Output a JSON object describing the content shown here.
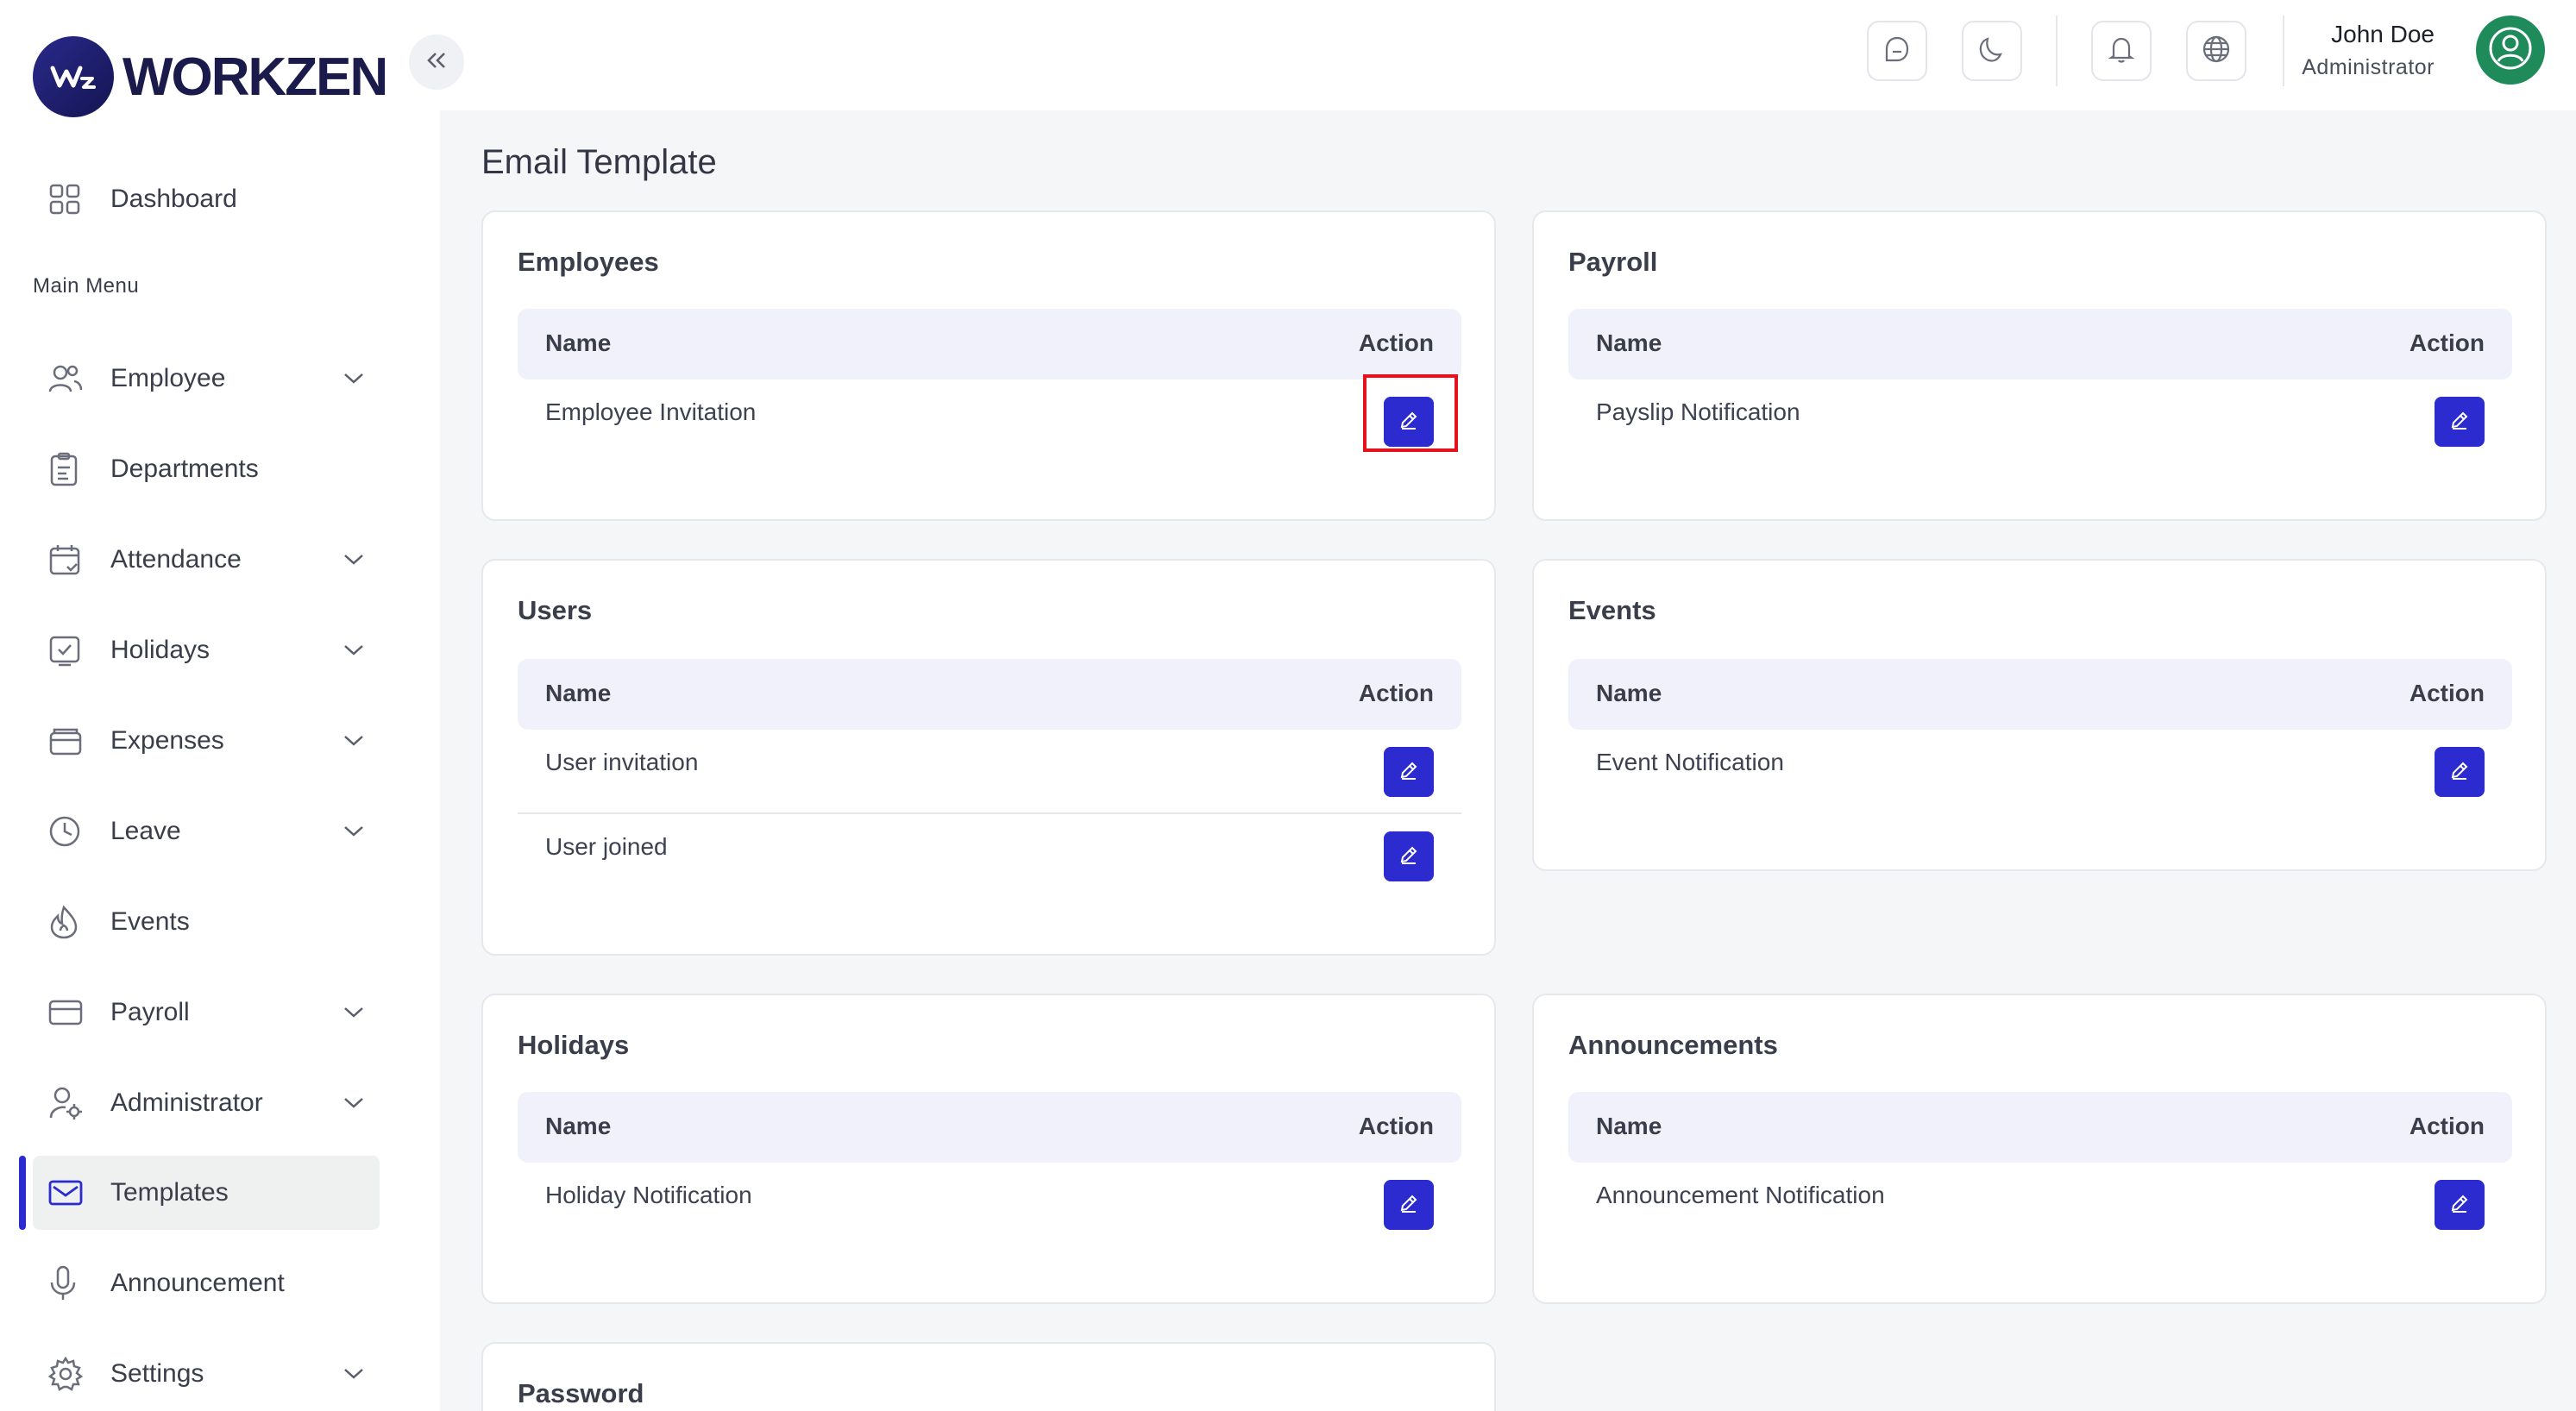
{
  "brand": {
    "name": "WORKZEN"
  },
  "sidebar": {
    "dashboard": "Dashboard",
    "section": "Main Menu",
    "items": [
      {
        "label": "Employee",
        "icon": "users-icon",
        "expandable": true
      },
      {
        "label": "Departments",
        "icon": "clipboard-icon",
        "expandable": false
      },
      {
        "label": "Attendance",
        "icon": "calendar-check-icon",
        "expandable": true
      },
      {
        "label": "Holidays",
        "icon": "calendar-tick-icon",
        "expandable": true
      },
      {
        "label": "Expenses",
        "icon": "wallet-icon",
        "expandable": true
      },
      {
        "label": "Leave",
        "icon": "clock-icon",
        "expandable": true
      },
      {
        "label": "Events",
        "icon": "flame-icon",
        "expandable": false
      },
      {
        "label": "Payroll",
        "icon": "credit-card-icon",
        "expandable": true
      },
      {
        "label": "Administrator",
        "icon": "user-gear-icon",
        "expandable": true
      },
      {
        "label": "Templates",
        "icon": "mail-icon",
        "expandable": false,
        "active": true
      },
      {
        "label": "Announcement",
        "icon": "microphone-icon",
        "expandable": false
      },
      {
        "label": "Settings",
        "icon": "gear-icon",
        "expandable": true
      }
    ]
  },
  "topbar": {
    "user_name": "John Doe",
    "user_role": "Administrator"
  },
  "page": {
    "title": "Email Template"
  },
  "columns": {
    "name": "Name",
    "action": "Action"
  },
  "cards": {
    "employees": {
      "title": "Employees",
      "rows": [
        "Employee Invitation"
      ]
    },
    "payroll": {
      "title": "Payroll",
      "rows": [
        "Payslip Notification"
      ]
    },
    "users": {
      "title": "Users",
      "rows": [
        "User invitation",
        "User joined"
      ]
    },
    "events": {
      "title": "Events",
      "rows": [
        "Event Notification"
      ]
    },
    "holidays": {
      "title": "Holidays",
      "rows": [
        "Holiday Notification"
      ]
    },
    "announcements": {
      "title": "Announcements",
      "rows": [
        "Announcement Notification"
      ]
    },
    "password": {
      "title": "Password"
    }
  },
  "colors": {
    "accent": "#2b2bd0",
    "highlight": "#e5121d",
    "avatar": "#1f8a5a"
  }
}
